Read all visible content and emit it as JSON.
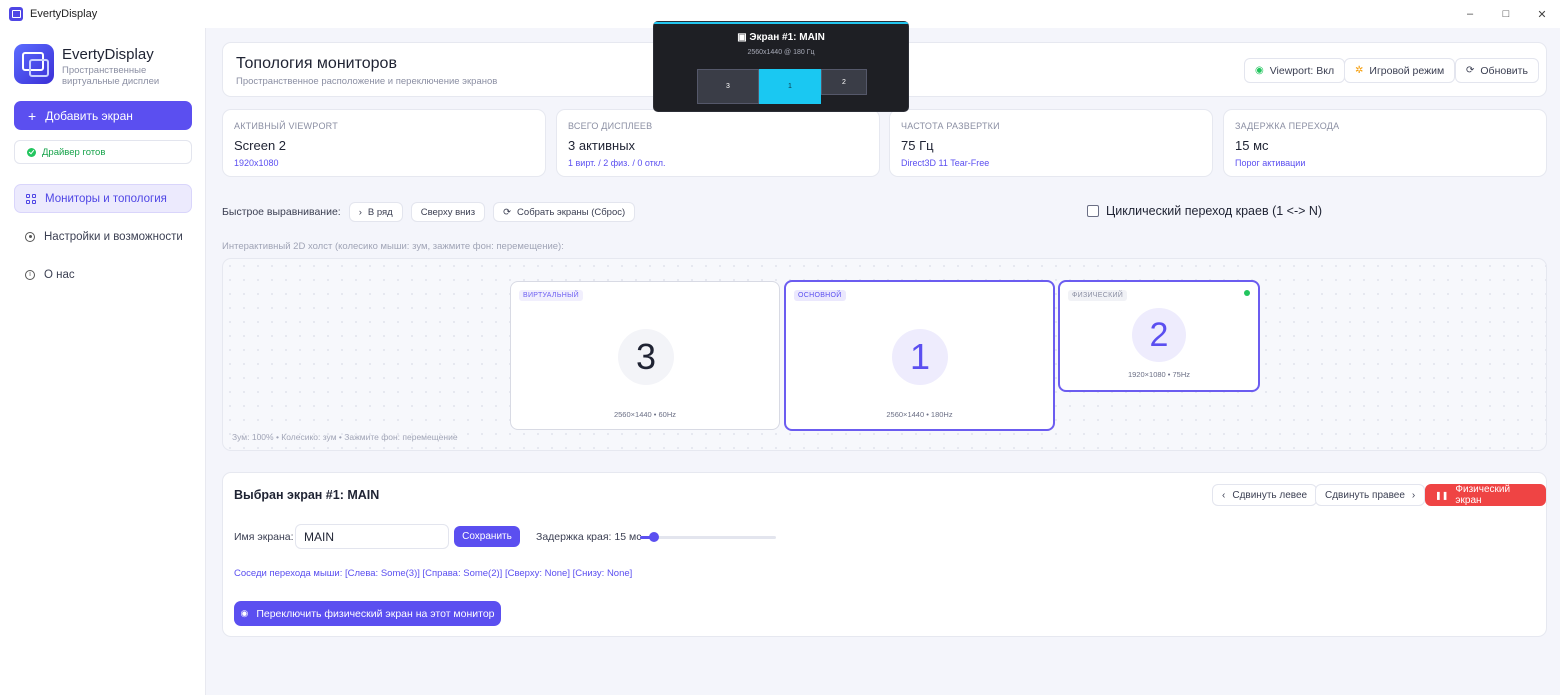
{
  "window": {
    "title": "EvertyDisplay",
    "controls": [
      "–",
      "□",
      "✕"
    ]
  },
  "brand": {
    "name": "EvertyDisplay",
    "subtitle_line1": "Пространственные",
    "subtitle_line2": "виртуальные дисплеи"
  },
  "sidebar": {
    "add_label": "Добавить экран",
    "driver_status": "Драйвер готов",
    "items": [
      {
        "label": "Мониторы и топология",
        "icon": "grid-icon",
        "active": true
      },
      {
        "label": "Настройки и возможности",
        "icon": "settings-icon",
        "active": false
      },
      {
        "label": "О нас",
        "icon": "info-icon",
        "active": false
      }
    ]
  },
  "header": {
    "title": "Топология мониторов",
    "subtitle": "Пространственное расположение и переключение экранов",
    "viewport_label": "Viewport: Вкл",
    "game_mode_label": "Игровой режим",
    "refresh_label": "Обновить"
  },
  "stats": [
    {
      "label": "АКТИВНЫЙ VIEWPORT",
      "value": "Screen 2",
      "sub": "1920x1080"
    },
    {
      "label": "ВСЕГО ДИСПЛЕЕВ",
      "value": "3 активных",
      "sub": "1 вирт. / 2 физ. / 0 откл."
    },
    {
      "label": "ЧАСТОТА РАЗВЕРТКИ",
      "value": "75 Гц",
      "sub": "Direct3D 11 Tear-Free"
    },
    {
      "label": "ЗАДЕРЖКА ПЕРЕХОДА",
      "value": "15 мс",
      "sub": "Порог активации"
    }
  ],
  "align": {
    "label": "Быстрое выравнивание:",
    "row": "В ряд",
    "top_down": "Сверху вниз",
    "reset": "Собрать экраны (Сброс)"
  },
  "cyclic": {
    "label": "Циклический переход краев (1 <-> N)",
    "checked": false
  },
  "canvas": {
    "caption": "Интерактивный 2D холст (колесико мыши: зум, зажмите фон: перемещение):",
    "footer": "Зум: 100%  •  Колесико: зум  •  Зажмите фон: перемещение",
    "monitors": [
      {
        "badge": "ВИРТУАЛЬНЫЙ",
        "number": "3",
        "res": "2560×1440  •  60Hz"
      },
      {
        "badge": "ОСНОВНОЙ",
        "number": "1",
        "res": "2560×1440  •  180Hz"
      },
      {
        "badge": "ФИЗИЧЕСКИЙ",
        "number": "2",
        "res": "1920×1080  •  75Hz"
      }
    ]
  },
  "selected": {
    "title": "Выбран экран #1: MAIN",
    "move_left": "Сдвинуть левее",
    "move_right": "Сдвинуть правее",
    "physical": "Физический экран",
    "name_label": "Имя экрана:",
    "name_value": "MAIN",
    "save_label": "Сохранить",
    "delay_label": "Задержка края: 15 мс",
    "delay_fraction": 0.1,
    "neighbors": "Соседи перехода мыши: [Слева: Some(3)]  [Справа: Some(2)]  [Сверху: None]  [Снизу: None]",
    "switch_label": "Переключить физический экран на этот монитор"
  },
  "overlay": {
    "title": "Экран #1: MAIN",
    "subtitle": "2560x1440 @ 180 Гц",
    "monitors": [
      "3",
      "1",
      "2"
    ]
  },
  "colors": {
    "accent": "#5b4ff0",
    "overlay_accent": "#22c6f0",
    "danger": "#ef4444",
    "success": "#22c55e"
  }
}
